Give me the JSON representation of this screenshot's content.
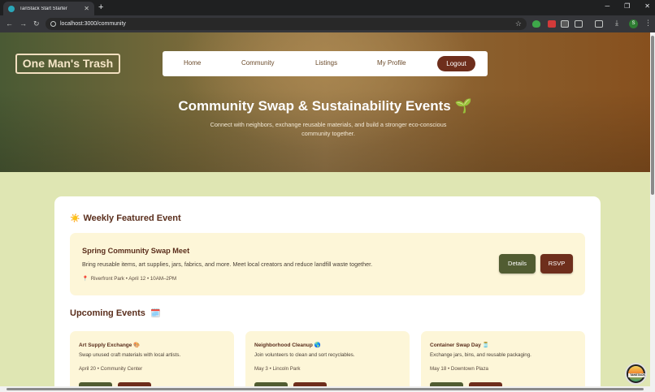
{
  "browser": {
    "tab_title": "TanStack Start Starter",
    "url": "localhost:3000/community",
    "new_tab_symbol": "+",
    "profile_initial": "S"
  },
  "site": {
    "logo": "One Man's Trash",
    "nav": [
      "Home",
      "Community",
      "Listings",
      "My Profile"
    ],
    "logout": "Logout"
  },
  "hero": {
    "title": "Community Swap & Sustainability Events",
    "title_icon": "🌱",
    "subtitle": "Connect with neighbors, exchange reusable materials, and build a stronger eco-conscious community together."
  },
  "featured_section": {
    "icon": "☀️",
    "title": "Weekly Featured Event"
  },
  "featured_event": {
    "title": "Spring Community Swap Meet",
    "description": "Bring reusable items, art supplies, jars, fabrics, and more. Meet local creators and reduce landfill waste together.",
    "meta": "Riverfront Park • April 12 • 10AM–2PM",
    "details_label": "Details",
    "rsvp_label": "RSVP"
  },
  "upcoming_section": {
    "icon": "🗓️",
    "title": "Upcoming Events"
  },
  "events": [
    {
      "title": "Art Supply Exchange",
      "icon": "🎨",
      "description": "Swap unused craft materials with local artists.",
      "meta": "April 20 • Community Center"
    },
    {
      "title": "Neighborhood Cleanup",
      "icon": "🌎",
      "description": "Join volunteers to clean and sort recyclables.",
      "meta": "May 3 • Lincoln Park"
    },
    {
      "title": "Container Swap Day",
      "icon": "🫙",
      "description": "Exchange jars, bins, and reusable packaging.",
      "meta": "May 18 • Downtown Plaza"
    }
  ],
  "devtools_badge": "TANSTACK",
  "colors": {
    "accent_brown": "#6e2e1c",
    "accent_green": "#515c32",
    "card_cream": "#fdf6d8",
    "page_bg": "#dfe6b3"
  }
}
